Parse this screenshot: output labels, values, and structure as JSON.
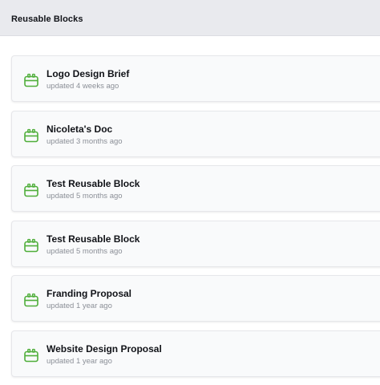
{
  "header": {
    "title": "Reusable Blocks"
  },
  "colors": {
    "icon_green": "#4fae3a",
    "card_bg": "#f9fafb",
    "header_bg": "#e9eaee"
  },
  "blocks": [
    {
      "title": "Logo Design Brief",
      "updated": "updated 4 weeks ago",
      "icon": "reusable-block-icon"
    },
    {
      "title": "Nicoleta's Doc",
      "updated": "updated 3 months ago",
      "icon": "reusable-block-icon"
    },
    {
      "title": "Test Reusable Block",
      "updated": "updated 5 months ago",
      "icon": "reusable-block-icon"
    },
    {
      "title": "Test Reusable Block",
      "updated": "updated 5 months ago",
      "icon": "reusable-block-icon"
    },
    {
      "title": "Franding Proposal",
      "updated": "updated 1 year ago",
      "icon": "reusable-block-icon"
    },
    {
      "title": "Website Design Proposal",
      "updated": "updated 1 year ago",
      "icon": "reusable-block-icon"
    }
  ]
}
